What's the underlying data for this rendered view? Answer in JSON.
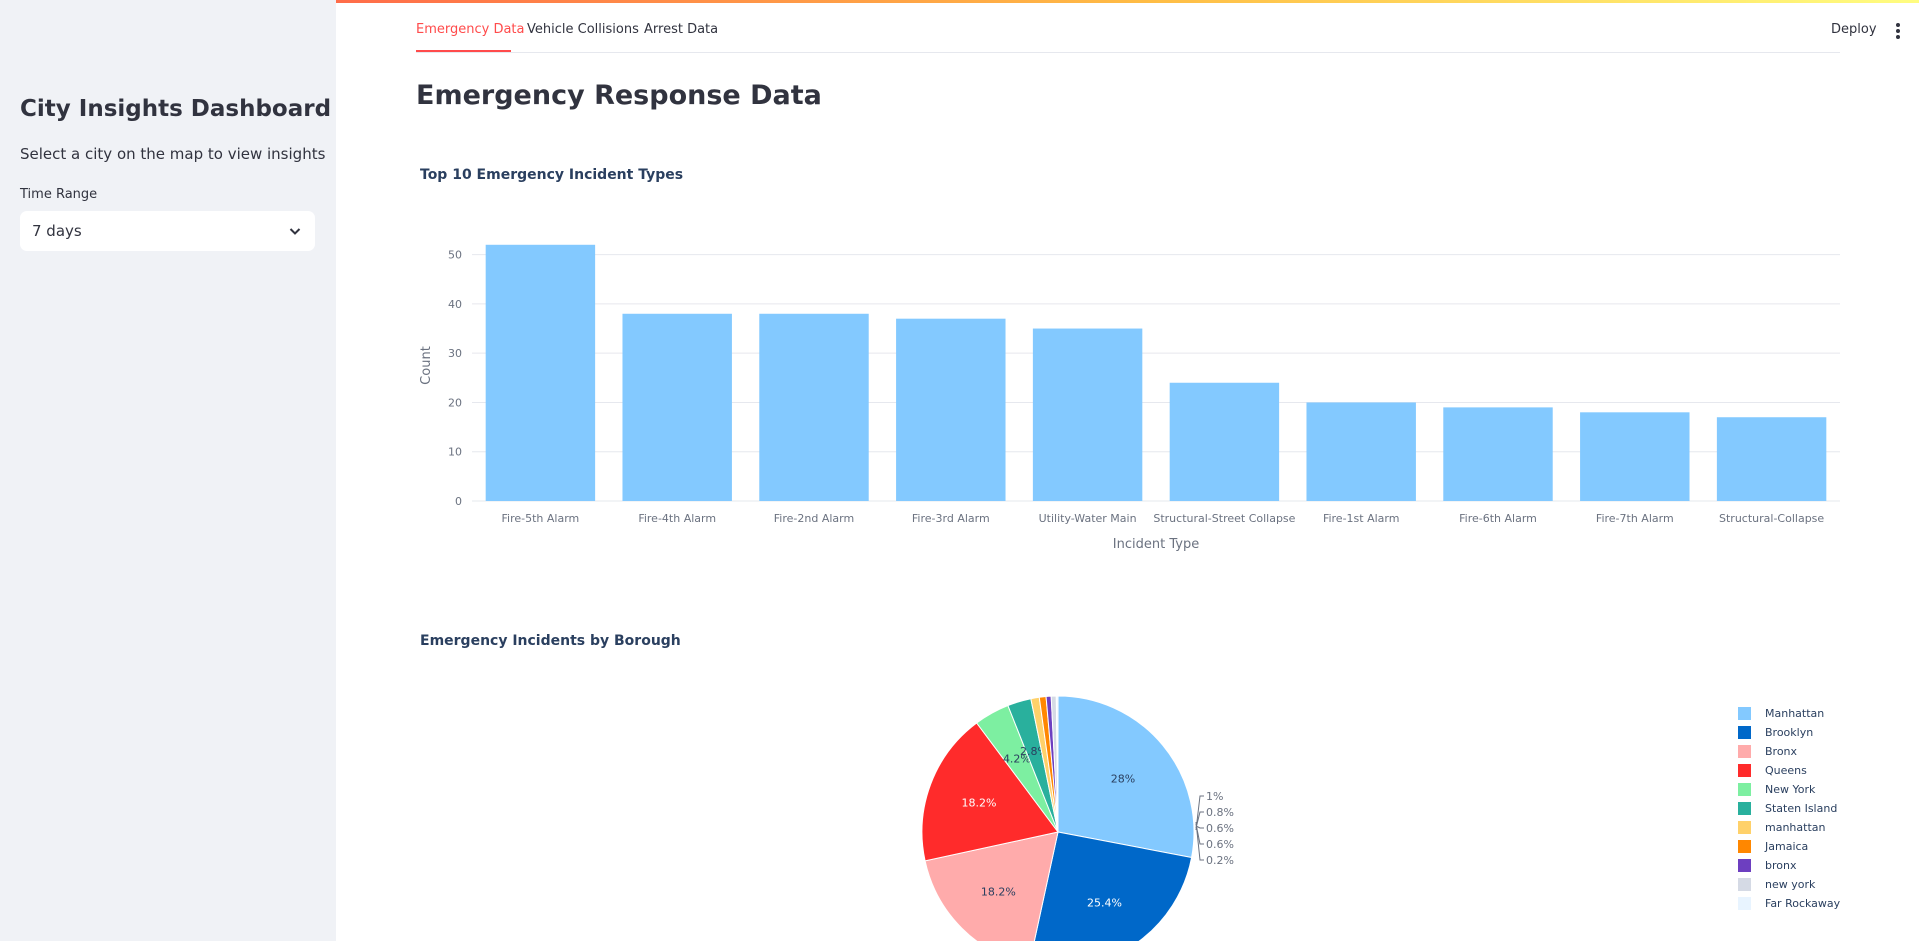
{
  "sidebar": {
    "title": "City Insights Dashboard",
    "subtitle": "Select a city on the map to view insights",
    "time_range_label": "Time Range",
    "time_range_value": "7 days"
  },
  "tabs": [
    {
      "label": "Emergency Data",
      "active": true
    },
    {
      "label": "Vehicle Collisions",
      "active": false
    },
    {
      "label": "Arrest Data",
      "active": false
    }
  ],
  "header": {
    "deploy_label": "Deploy"
  },
  "main": {
    "page_title": "Emergency Response Data"
  },
  "colors": {
    "accent": "#ff4b4b",
    "bar": "#83c9ff",
    "sidebar_bg": "#f0f2f6"
  },
  "chart_data": [
    {
      "type": "bar",
      "title": "Top 10 Emergency Incident Types",
      "xlabel": "Incident Type",
      "ylabel": "Count",
      "categories": [
        "Fire-5th Alarm",
        "Fire-4th Alarm",
        "Fire-2nd Alarm",
        "Fire-3rd Alarm",
        "Utility-Water Main",
        "Structural-Street Collapse",
        "Fire-1st Alarm",
        "Fire-6th Alarm",
        "Fire-7th Alarm",
        "Structural-Collapse"
      ],
      "values": [
        52,
        38,
        38,
        37,
        35,
        24,
        20,
        19,
        18,
        17
      ],
      "ylim": [
        0,
        55
      ],
      "yticks": [
        "0",
        "10",
        "20",
        "30",
        "40",
        "50"
      ],
      "grid": true,
      "color": "#83c9ff"
    },
    {
      "type": "pie",
      "title": "Emergency Incidents by Borough",
      "legend_position": "right",
      "slices": [
        {
          "label": "Manhattan",
          "value": 28,
          "text": "28%",
          "color": "#83c9ff"
        },
        {
          "label": "Brooklyn",
          "value": 25.4,
          "text": "25.4%",
          "color": "#0068c9"
        },
        {
          "label": "Bronx",
          "value": 18.2,
          "text": "18.2%",
          "color": "#ffabab"
        },
        {
          "label": "Queens",
          "value": 18.2,
          "text": "18.2%",
          "color": "#ff2b2b"
        },
        {
          "label": "New York",
          "value": 4.2,
          "text": "4.2%",
          "color": "#7defa1"
        },
        {
          "label": "Staten Island",
          "value": 2.8,
          "text": "2.8%",
          "color": "#29b09d"
        },
        {
          "label": "manhattan",
          "value": 1,
          "text": "1%",
          "color": "#ffd16a"
        },
        {
          "label": "Jamaica",
          "value": 0.8,
          "text": "0.8%",
          "color": "#ff8700"
        },
        {
          "label": "bronx",
          "value": 0.6,
          "text": "0.6%",
          "color": "#6d3fc0"
        },
        {
          "label": "new york",
          "value": 0.6,
          "text": "0.6%",
          "color": "#d5dae5"
        },
        {
          "label": "Far Rockaway",
          "value": 0.2,
          "text": "0.2%",
          "color": "#e8f4ff"
        }
      ]
    }
  ]
}
